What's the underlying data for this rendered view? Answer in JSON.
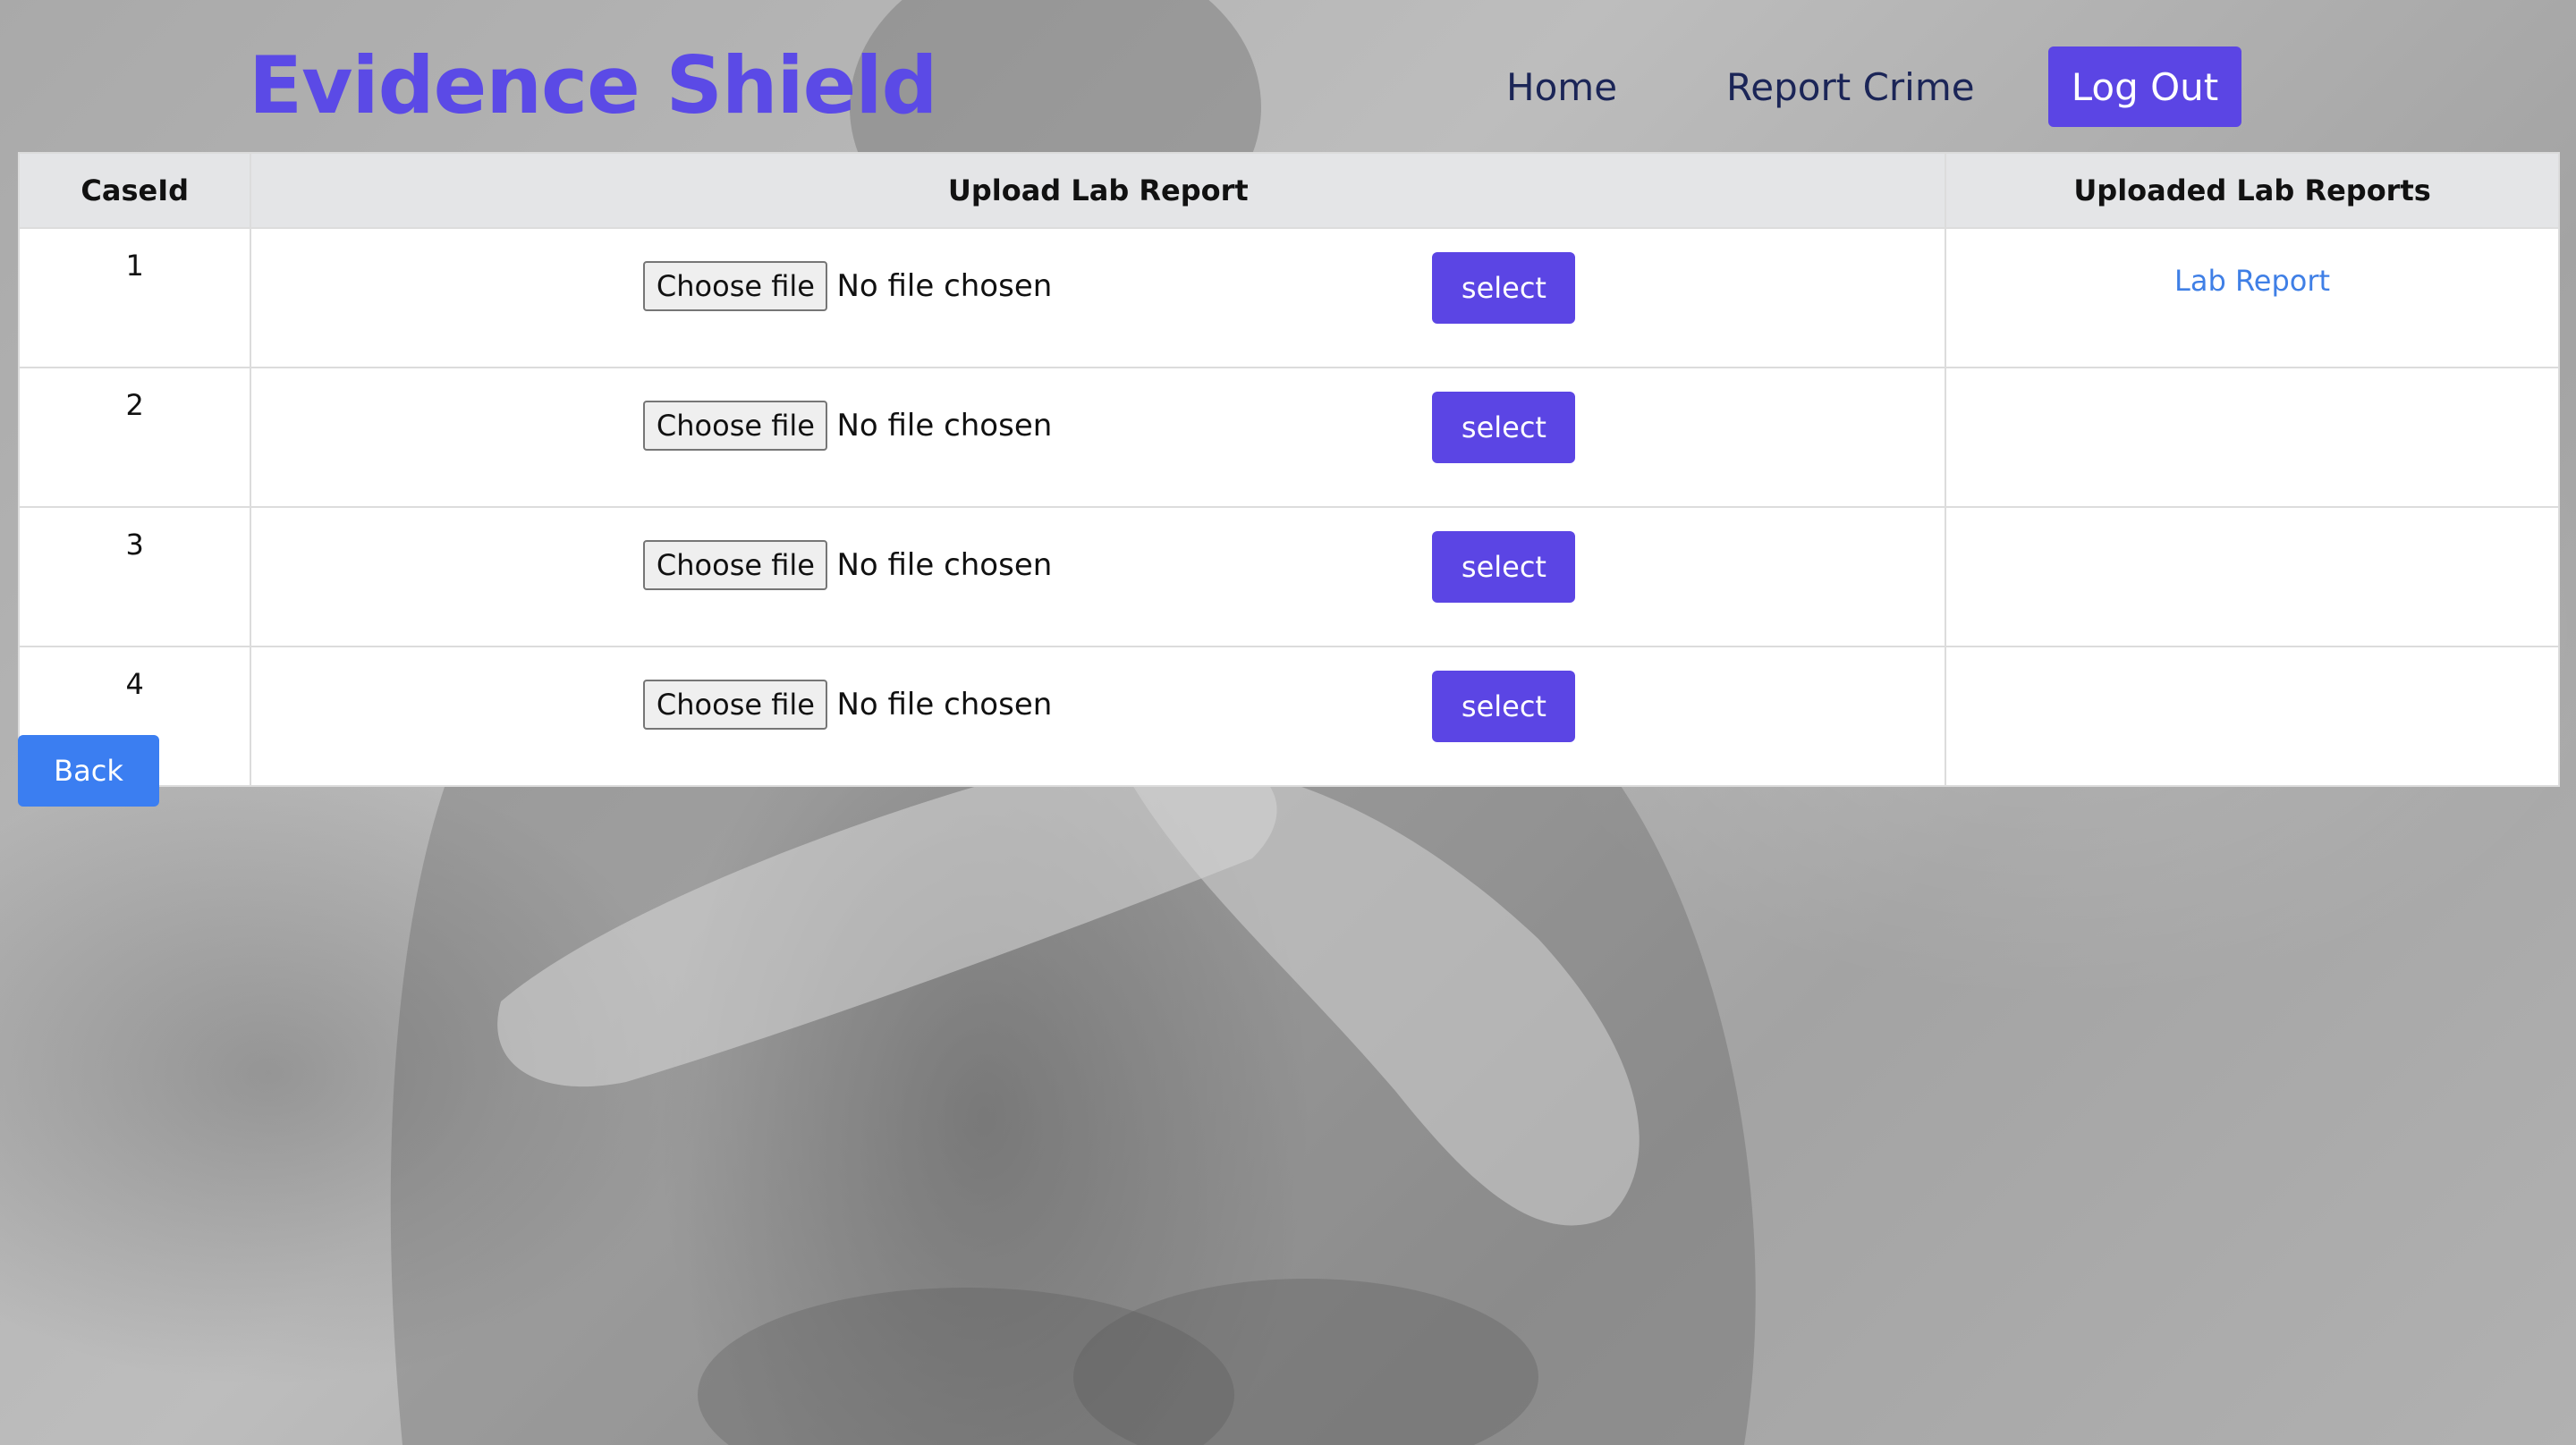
{
  "header": {
    "brand": "Evidence Shield",
    "nav": {
      "home": "Home",
      "report_crime": "Report Crime",
      "logout": "Log Out"
    }
  },
  "table": {
    "columns": [
      "CaseId",
      "Upload Lab Report",
      "Uploaded Lab Reports"
    ],
    "rows": [
      {
        "case_id": "1",
        "choose_label": "Choose file",
        "file_status": "No file chosen",
        "select_label": "select",
        "uploaded": "Lab Report"
      },
      {
        "case_id": "2",
        "choose_label": "Choose file",
        "file_status": "No file chosen",
        "select_label": "select",
        "uploaded": ""
      },
      {
        "case_id": "3",
        "choose_label": "Choose file",
        "file_status": "No file chosen",
        "select_label": "select",
        "uploaded": ""
      },
      {
        "case_id": "4",
        "choose_label": "Choose file",
        "file_status": "No file chosen",
        "select_label": "select",
        "uploaded": ""
      }
    ]
  },
  "back_label": "Back",
  "colors": {
    "brand": "#5b4ae6",
    "primary_button": "#5b45e4",
    "back_button": "#3b7ef1",
    "link": "#3f7fe6",
    "nav_text": "#1b2557"
  }
}
